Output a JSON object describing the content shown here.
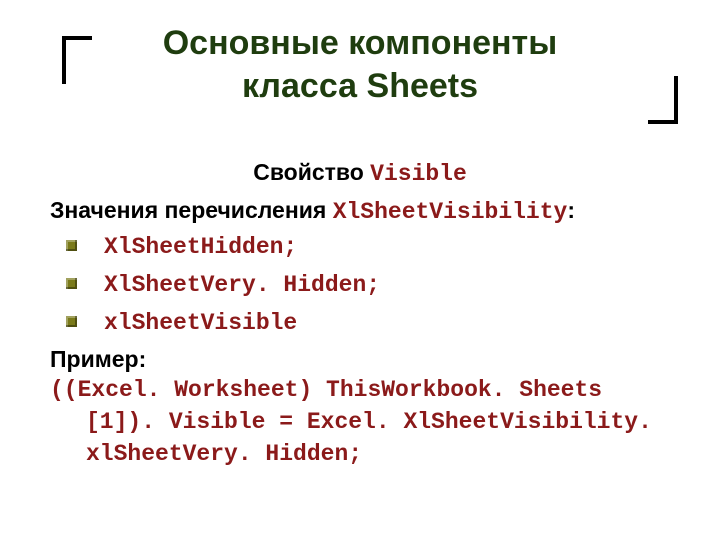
{
  "title": {
    "line1": "Основные компоненты",
    "line2": "класса Sheets"
  },
  "subtitle": {
    "label": "Свойство ",
    "code": "Visible"
  },
  "enum_intro": {
    "label": "Значения перечисления ",
    "code": "XlSheetVisibility",
    "suffix": ":"
  },
  "bullets": [
    " XlSheetHidden;",
    "  XlSheetVery. Hidden;",
    "  xlSheetVisible"
  ],
  "example_label": "Пример:",
  "code": {
    "line1": "((Excel. Worksheet) ThisWorkbook. Sheets",
    "line2": "[1]). Visible = Excel. XlSheetVisibility.",
    "line3": "xlSheetVery. Hidden;"
  }
}
